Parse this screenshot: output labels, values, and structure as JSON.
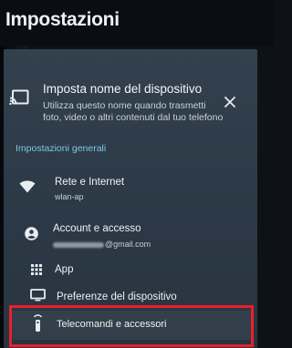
{
  "header": {
    "title": "Impostazioni"
  },
  "notification": {
    "icon": "cast-icon",
    "title": "Imposta nome del dispositivo",
    "description": "Utilizza questo nome quando trasmetti foto, video o altri contenuti dal tuo telefono",
    "close_icon": "close-icon"
  },
  "section": {
    "header": "Impostazioni generali"
  },
  "items": [
    {
      "icon": "wifi-icon",
      "label": "Rete e Internet",
      "sub": "wlan-ap"
    },
    {
      "icon": "account-icon",
      "label": "Account e accesso",
      "sub": "@gmail.com"
    },
    {
      "icon": "apps-grid-icon",
      "label": "App"
    },
    {
      "icon": "tv-icon",
      "label": "Preferenze del dispositivo"
    },
    {
      "icon": "remote-icon",
      "label": "Telecomandi e accessori"
    }
  ],
  "colors": {
    "panel": "#2f3b48",
    "section_header": "#7fc7ee",
    "highlight_border": "#ec1f2b"
  }
}
